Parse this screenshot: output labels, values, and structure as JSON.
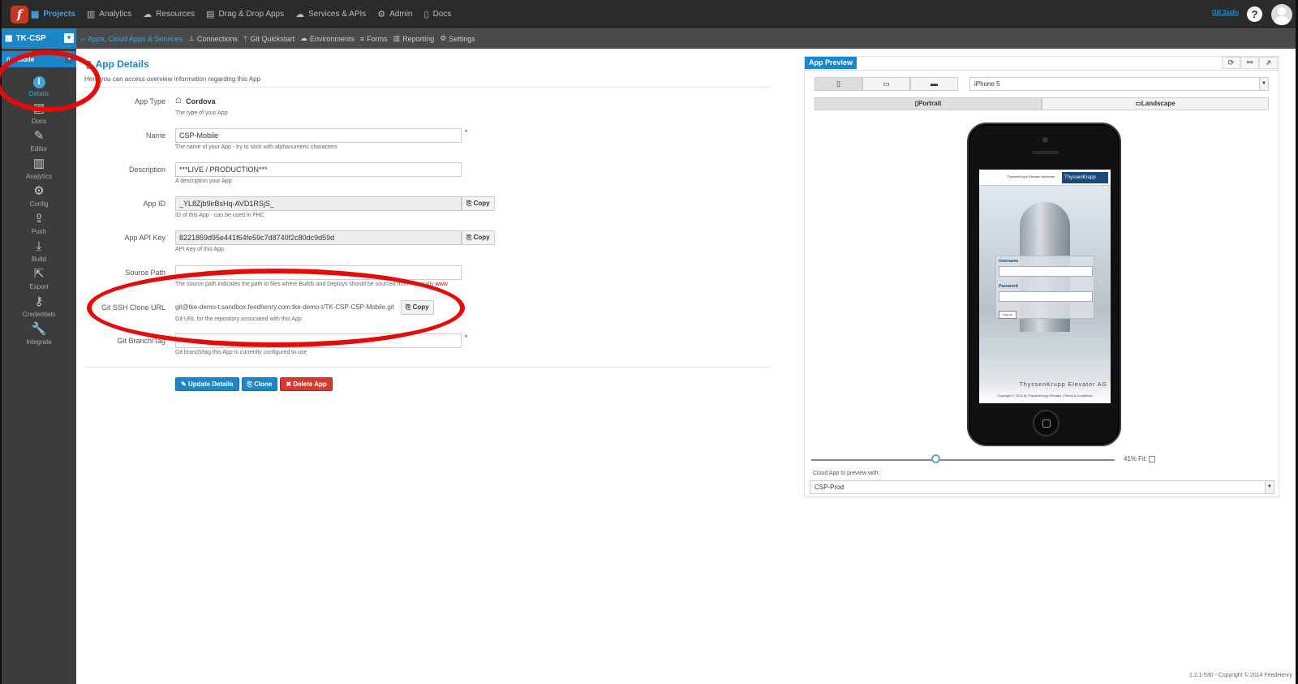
{
  "topnav": {
    "items": [
      {
        "label": "Projects",
        "icon": "grid-icon"
      },
      {
        "label": "Analytics",
        "icon": "bar-chart-icon"
      },
      {
        "label": "Resources",
        "icon": "cloud-icon"
      },
      {
        "label": "Drag & Drop Apps",
        "icon": "layers-icon"
      },
      {
        "label": "Services & APIs",
        "icon": "cloud-icon"
      },
      {
        "label": "Admin",
        "icon": "gears-icon"
      },
      {
        "label": "Docs",
        "icon": "book-icon"
      }
    ],
    "old_studio": "Old Studio"
  },
  "project": {
    "name": "TK-CSP"
  },
  "subnav": {
    "items": [
      {
        "label": "Apps, Cloud Apps & Services"
      },
      {
        "label": "Connections"
      },
      {
        "label": "Git Quickstart"
      },
      {
        "label": "Environments"
      },
      {
        "label": "Forms"
      },
      {
        "label": "Reporting"
      },
      {
        "label": "Settings"
      }
    ]
  },
  "sidebar": {
    "app_name": "mobile",
    "items": [
      {
        "label": "Details",
        "icon": "info-icon"
      },
      {
        "label": "Docs",
        "icon": "book-icon"
      },
      {
        "label": "Editor",
        "icon": "edit-icon"
      },
      {
        "label": "Analytics",
        "icon": "bar-chart-icon"
      },
      {
        "label": "Config",
        "icon": "gear-icon"
      },
      {
        "label": "Push",
        "icon": "upload-icon"
      },
      {
        "label": "Build",
        "icon": "download-icon"
      },
      {
        "label": "Export",
        "icon": "export-icon"
      },
      {
        "label": "Credentials",
        "icon": "key-icon"
      },
      {
        "label": "Integrate",
        "icon": "wrench-icon"
      }
    ]
  },
  "details": {
    "title": "App Details",
    "subtitle": "Here you can access overview information regarding this App",
    "fields": {
      "app_type": {
        "label": "App Type",
        "value": "Cordova",
        "help": "The type of your App"
      },
      "name": {
        "label": "Name",
        "value": "CSP-Mobile",
        "help": "The name of your App - try to stick with alphanumeric characters",
        "required": "*"
      },
      "description": {
        "label": "Description",
        "value": "***LIVE / PRODUCTION***",
        "help": "A description your App"
      },
      "app_id": {
        "label": "App ID",
        "value": "_YL8Zjb9irBsHq-AVD1RSjS_",
        "help": "ID of this App - can be used in FHC",
        "copy": "Copy"
      },
      "api_key": {
        "label": "App API Key",
        "value": "8221859d95e441f64fe59c7d8740f2c80dc9d59d",
        "help": "API Key of this App",
        "copy": "Copy"
      },
      "source_path": {
        "label": "Source Path",
        "value": "",
        "help": "The source path indicates the path to files where Builds and Deploys should be sourced from - typically",
        "help_link": "www"
      },
      "git_url": {
        "label": "Git SSH Clone URL",
        "value": "git@tke-demo-t.sandbox.feedhenry.com:tke-demo-t/TK-CSP-CSP-Mobile.git",
        "help": "Git URL for the repository associated with this App",
        "copy": "Copy"
      },
      "git_branch": {
        "label": "Git Branch/Tag",
        "value": "",
        "help": "Git branch/tag this App is currently configured to use",
        "required": "*"
      }
    },
    "buttons": {
      "update": "Update Details",
      "clone": "Clone",
      "delete": "Delete App"
    }
  },
  "preview": {
    "tab": "App Preview",
    "device": "iPhone 5",
    "portrait": "Portrait",
    "landscape": "Landscape",
    "zoom": 41,
    "zoom_label": "41%",
    "fit_label": "Fit:",
    "cloud_label": "Cloud App to preview with:",
    "cloud_app": "CSP-Prod",
    "screen": {
      "company": "ThyssenKrupp Elevator Americas",
      "brand": "ThyssenKrupp",
      "username": "Username",
      "password": "Password",
      "login_btn": "Log on",
      "footer_title": "ThyssenKrupp Elevator AG",
      "footer_copy": "Copyright © 2014 by ThyssenKrupp Elevator  |  Terms & Conditions"
    }
  },
  "footer": "1.2.1-530 - Copyright © 2014 FeedHenry",
  "colors": {
    "accent": "#1b86c8",
    "danger": "#d63a2e",
    "annotation": "#e50b0b"
  }
}
